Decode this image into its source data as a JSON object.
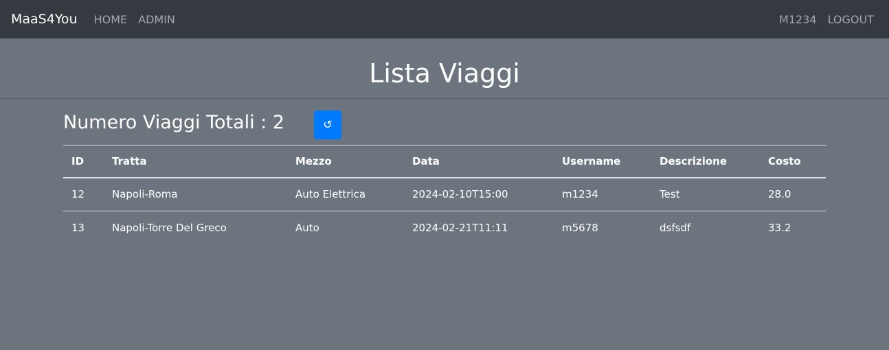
{
  "nav": {
    "brand": "MaaS4You",
    "links": [
      "HOME",
      "ADMIN"
    ],
    "user": "M1234",
    "logout": "LOGOUT"
  },
  "page": {
    "title": "Lista Viaggi",
    "count_label": "Numero Viaggi Totali : 2",
    "refresh_icon": "↺",
    "refresh_icon_name": "refresh-icon",
    "accent_color": "#007bff"
  },
  "table": {
    "headers": [
      "ID",
      "Tratta",
      "Mezzo",
      "Data",
      "Username",
      "Descrizione",
      "Costo"
    ],
    "rows": [
      [
        "12",
        "Napoli-Roma",
        "Auto Elettrica",
        "2024-02-10T15:00",
        "m1234",
        "Test",
        "28.0"
      ],
      [
        "13",
        "Napoli-Torre Del Greco",
        "Auto",
        "2024-02-21T11:11",
        "m5678",
        "dsfsdf",
        "33.2"
      ]
    ]
  }
}
